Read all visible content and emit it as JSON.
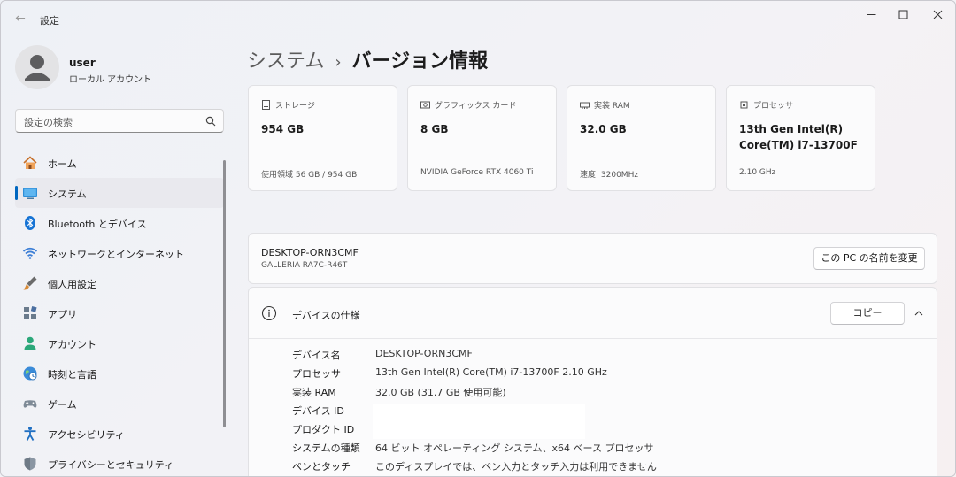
{
  "titlebar": {
    "title": "設定",
    "back_icon": "back-arrow-icon"
  },
  "profile": {
    "name": "user",
    "account_type": "ローカル アカウント"
  },
  "search": {
    "placeholder": "設定の検索"
  },
  "nav": {
    "items": [
      {
        "label": "ホーム",
        "icon": "home-icon"
      },
      {
        "label": "システム",
        "icon": "system-icon",
        "active": true
      },
      {
        "label": "Bluetooth とデバイス",
        "icon": "bluetooth-icon"
      },
      {
        "label": "ネットワークとインターネット",
        "icon": "network-icon"
      },
      {
        "label": "個人用設定",
        "icon": "personalization-icon"
      },
      {
        "label": "アプリ",
        "icon": "apps-icon"
      },
      {
        "label": "アカウント",
        "icon": "accounts-icon"
      },
      {
        "label": "時刻と言語",
        "icon": "time-language-icon"
      },
      {
        "label": "ゲーム",
        "icon": "gaming-icon"
      },
      {
        "label": "アクセシビリティ",
        "icon": "accessibility-icon"
      },
      {
        "label": "プライバシーとセキュリティ",
        "icon": "privacy-icon"
      }
    ]
  },
  "breadcrumb": {
    "parent": "システム",
    "separator": "›",
    "current": "バージョン情報"
  },
  "cards": [
    {
      "label": "ストレージ",
      "value": "954 GB",
      "sub": "使用領域 56 GB / 954 GB",
      "icon": "storage-icon"
    },
    {
      "label": "グラフィックス カード",
      "value": "8 GB",
      "sub": "NVIDIA GeForce RTX 4060 Ti",
      "icon": "gpu-icon"
    },
    {
      "label": "実装 RAM",
      "value": "32.0 GB",
      "sub": "速度: 3200MHz",
      "icon": "ram-icon"
    },
    {
      "label": "プロセッサ",
      "value": "13th Gen Intel(R) Core(TM) i7-13700F",
      "sub": "2.10 GHz",
      "icon": "processor-icon"
    }
  ],
  "pc": {
    "name": "DESKTOP-ORN3CMF",
    "model": "GALLERIA RA7C-R46T",
    "rename_label": "この PC の名前を変更"
  },
  "specs": {
    "title": "デバイスの仕様",
    "copy_label": "コピー",
    "rows": [
      {
        "key": "デバイス名",
        "value": "DESKTOP-ORN3CMF"
      },
      {
        "key": "プロセッサ",
        "value": "13th Gen Intel(R) Core(TM) i7-13700F   2.10 GHz"
      },
      {
        "key": "実装 RAM",
        "value": "32.0 GB (31.7 GB 使用可能)"
      },
      {
        "key": "デバイス ID",
        "value": ""
      },
      {
        "key": "プロダクト ID",
        "value": ""
      },
      {
        "key": "システムの種類",
        "value": "64 ビット オペレーティング システム、x64 ベース プロセッサ"
      },
      {
        "key": "ペンとタッチ",
        "value": "このディスプレイでは、ペン入力とタッチ入力は利用できません"
      }
    ]
  },
  "colors": {
    "accent": "#0067c0"
  }
}
